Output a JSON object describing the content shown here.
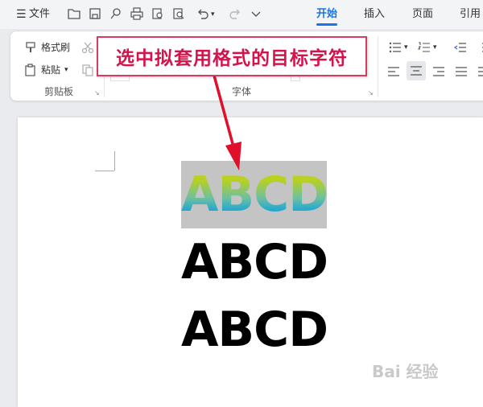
{
  "menu": {
    "file_label": "文件",
    "tabs": [
      {
        "label": "开始",
        "active": true
      },
      {
        "label": "插入",
        "active": false
      },
      {
        "label": "页面",
        "active": false
      },
      {
        "label": "引用",
        "active": false
      }
    ],
    "accent_color": "#1a73e8"
  },
  "ribbon": {
    "format_painter_label": "格式刷",
    "paste_label": "粘贴",
    "clipboard_group_label": "剪贴板",
    "font_group_label": "字体"
  },
  "callout": {
    "text": "选中拟套用格式的目标字符",
    "color": "#d4134a"
  },
  "document": {
    "lines": [
      {
        "text": "ABCD",
        "style": "gradient-selected"
      },
      {
        "text": "ABCD",
        "style": "bold-black"
      },
      {
        "text": "ABCD",
        "style": "bold-black"
      }
    ]
  },
  "watermark": {
    "text": "Bai 经验"
  }
}
